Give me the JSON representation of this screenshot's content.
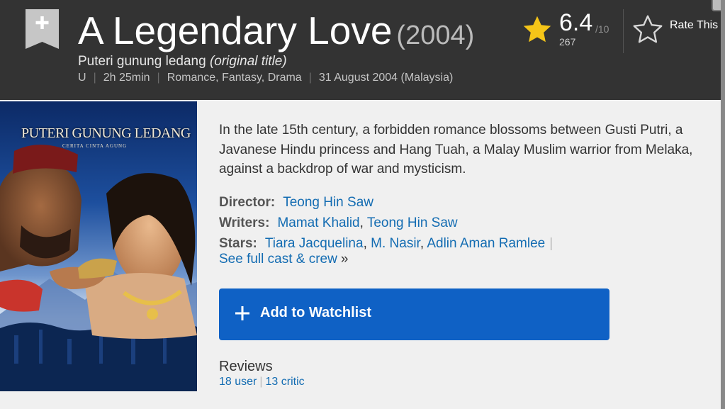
{
  "title": {
    "name": "A Legendary Love",
    "year": "(2004)"
  },
  "original_title": {
    "name": "Puteri gunung ledang",
    "note": "(original title)"
  },
  "meta": {
    "certificate": "U",
    "runtime": "2h 25min",
    "genres": "Romance, Fantasy, Drama",
    "release": "31 August 2004 (Malaysia)",
    "separator": "|"
  },
  "rating": {
    "value": "6.4",
    "best": "/10",
    "count": "267",
    "rate_label": "Rate This"
  },
  "poster": {
    "title": "PUTERI GUNUNG LEDANG",
    "subtitle": "CERITA CINTA AGUNG"
  },
  "plot": "In the late 15th century, a forbidden romance blossoms between Gusti Putri, a Javanese Hindu princess and Hang Tuah, a Malay Muslim warrior from Melaka, against a backdrop of war and mysticism.",
  "credits": {
    "director_label": "Director:",
    "directors": [
      "Teong Hin Saw"
    ],
    "writers_label": "Writers:",
    "writers": [
      "Mamat Khalid",
      "Teong Hin Saw"
    ],
    "stars_label": "Stars:",
    "stars": [
      "Tiara Jacquelina",
      "M. Nasir",
      "Adlin Aman Ramlee"
    ],
    "comma": ",",
    "pipe": "|",
    "full_cast": "See full cast & crew",
    "raquo": "»"
  },
  "watchlist_button": {
    "label": "Add to Watchlist"
  },
  "reviews": {
    "title": "Reviews",
    "user": "18 user",
    "critic": "13 critic",
    "separator": "|"
  },
  "colors": {
    "header_bg": "#333333",
    "link": "#136cb2",
    "button": "#0f61c5",
    "star": "#f5c518",
    "page_bg": "#f0f0f0"
  }
}
